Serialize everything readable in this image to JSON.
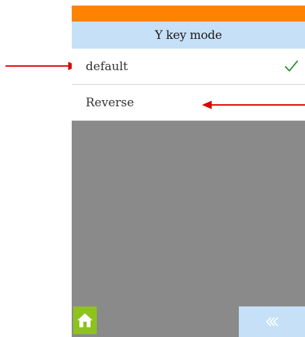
{
  "header": {
    "title": "Y key mode",
    "top_bar_color": "#ff8200",
    "title_bar_color": "#c6e0f7"
  },
  "options": [
    {
      "label": "default",
      "selected": true
    },
    {
      "label": "Reverse",
      "selected": false
    }
  ],
  "footer": {
    "home_icon": "home-icon",
    "home_color": "#8dc21f",
    "back_icon": "double-chevron-left-icon",
    "back_color": "#c6e0f7"
  },
  "annotations": {
    "arrow_color": "#e00000",
    "arrows": [
      {
        "points_to": "default",
        "direction": "right"
      },
      {
        "points_to": "Reverse",
        "direction": "left"
      }
    ]
  }
}
